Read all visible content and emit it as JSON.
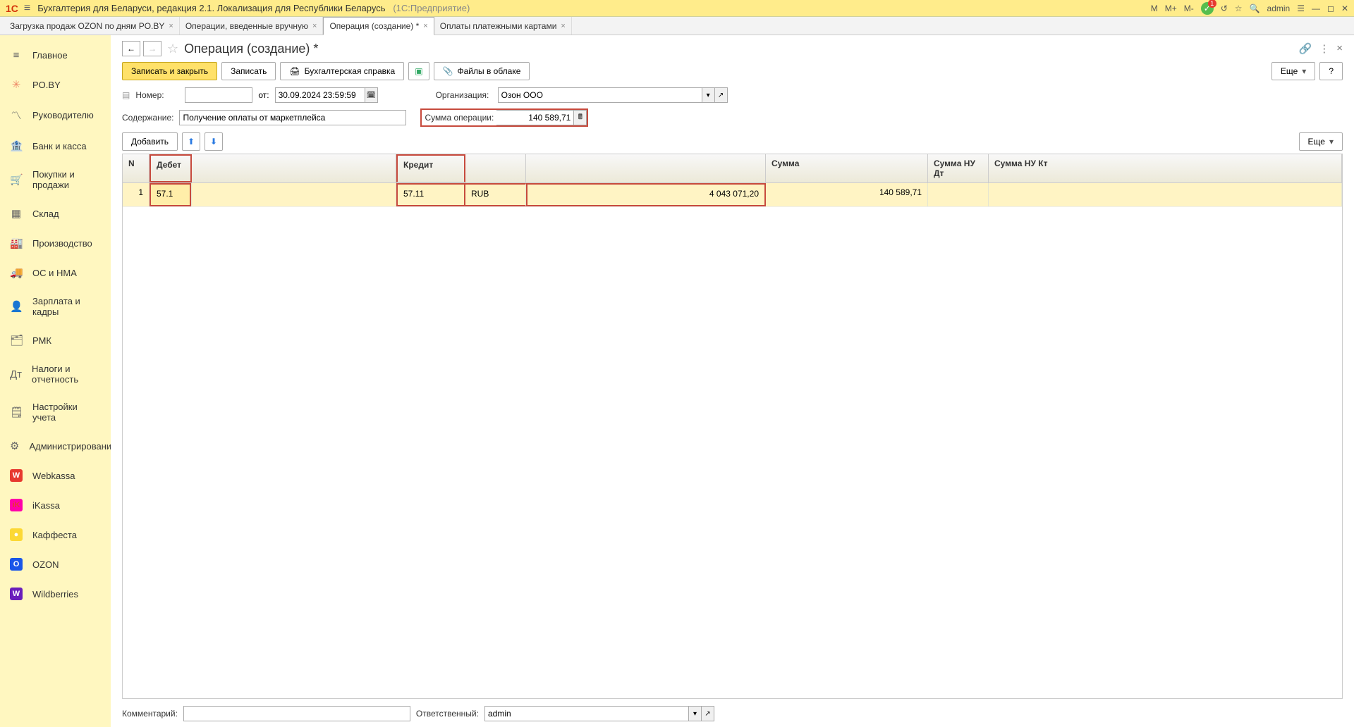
{
  "titlebar": {
    "app": "Бухгалтерия для Беларуси, редакция 2.1. Локализация для Республики Беларусь",
    "suffix": "(1С:Предприятие)",
    "m": "M",
    "mplus": "M+",
    "mminus": "M-",
    "user": "admin"
  },
  "tabs": [
    {
      "label": "Загрузка продаж OZON по дням PO.BY"
    },
    {
      "label": "Операции, введенные вручную"
    },
    {
      "label": "Операция (создание) *",
      "active": true
    },
    {
      "label": "Оплаты платежными картами"
    }
  ],
  "sidebar": [
    {
      "icon": "≡",
      "label": "Главное"
    },
    {
      "icon": "✳",
      "label": "PO.BY",
      "color": "#e86"
    },
    {
      "icon": "〽",
      "label": "Руководителю"
    },
    {
      "icon": "🏦",
      "label": "Банк и касса"
    },
    {
      "icon": "🛒",
      "label": "Покупки и продажи"
    },
    {
      "icon": "▦",
      "label": "Склад"
    },
    {
      "icon": "🏭",
      "label": "Производство"
    },
    {
      "icon": "🚚",
      "label": "ОС и НМА"
    },
    {
      "icon": "👤",
      "label": "Зарплата и кадры"
    },
    {
      "icon": "🗂",
      "label": "РМК"
    },
    {
      "icon": "Дт",
      "label": "Налоги и отчетность"
    },
    {
      "icon": "🗒",
      "label": "Настройки учета"
    },
    {
      "icon": "⚙",
      "label": "Администрирование"
    },
    {
      "icon": "W",
      "label": "Webkassa",
      "iconbg": "#e7392f"
    },
    {
      "icon": "iK",
      "label": "iKassa",
      "iconbg": "#f0a",
      "iconcolor": "#e7392f"
    },
    {
      "icon": "●",
      "label": "Каффеста",
      "iconbg": "#fcd835"
    },
    {
      "icon": "O",
      "label": "OZON",
      "iconbg": "#1b56e8"
    },
    {
      "icon": "W",
      "label": "Wildberries",
      "iconbg": "#6a1ebb"
    }
  ],
  "page": {
    "title": "Операция (создание) *"
  },
  "toolbar": {
    "save_close": "Записать и закрыть",
    "save": "Записать",
    "acct_ref": "Бухгалтерская справка",
    "files": "Файлы в облаке",
    "more": "Еще",
    "help": "?"
  },
  "form": {
    "number_label": "Номер:",
    "number_value": "",
    "date_label": "от:",
    "date_value": "30.09.2024 23:59:59",
    "org_label": "Организация:",
    "org_value": "Озон ООО",
    "content_label": "Содержание:",
    "content_value": "Получение оплаты от маркетплейса",
    "sum_label": "Сумма операции:",
    "sum_value": "140 589,71"
  },
  "tableToolbar": {
    "add": "Добавить",
    "more": "Еще"
  },
  "grid": {
    "headers": {
      "n": "N",
      "debit": "Дебет",
      "credit": "Кредит",
      "sum": "Сумма",
      "nudt": "Сумма НУ Дт",
      "nukt": "Сумма НУ Кт"
    },
    "rows": [
      {
        "n": "1",
        "debit": "57.1",
        "credit": "57.11",
        "cred2": "RUB",
        "cred3": "4 043 071,20",
        "sum": "140 589,71"
      }
    ]
  },
  "bottom": {
    "comment_label": "Комментарий:",
    "comment_value": "",
    "resp_label": "Ответственный:",
    "resp_value": "admin"
  }
}
